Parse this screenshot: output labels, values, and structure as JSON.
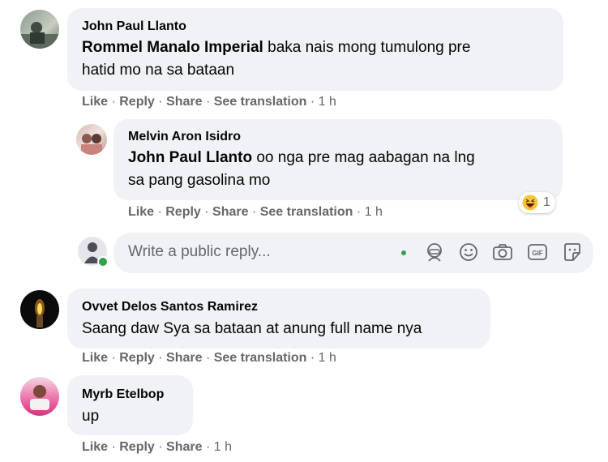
{
  "comments": [
    {
      "author": "John Paul Llanto",
      "mention": "Rommel Manalo Imperial",
      "text_line1": " baka nais mong tumulong pre",
      "text_line2": "hatid mo na sa bataan",
      "actions": {
        "like": "Like",
        "reply": "Reply",
        "share": "Share",
        "translate": "See translation",
        "time": "1 h"
      }
    },
    {
      "author": "Melvin Aron Isidro",
      "mention": "John Paul Llanto",
      "text_line1": " oo nga pre mag aabagan na lng",
      "text_line2": "sa pang gasolina mo",
      "reaction": {
        "emoji": "haha",
        "count": "1"
      },
      "actions": {
        "like": "Like",
        "reply": "Reply",
        "share": "Share",
        "translate": "See translation",
        "time": "1 h"
      }
    },
    {
      "author": "Ovvet Delos Santos Ramirez",
      "text_line1": "Saang daw Sya sa bataan at anung full name nya",
      "actions": {
        "like": "Like",
        "reply": "Reply",
        "share": "Share",
        "translate": "See translation",
        "time": "1 h"
      }
    },
    {
      "author": "Myrb Etelbop",
      "text_line1": "up",
      "actions": {
        "like": "Like",
        "reply": "Reply",
        "share": "Share",
        "time": "1 h"
      }
    }
  ],
  "reply_box": {
    "placeholder": "Write a public reply...",
    "tools": [
      "emoji-icon",
      "camera-icon",
      "gif-icon",
      "sticker-icon"
    ]
  },
  "separator": " · ",
  "colors": {
    "bubble": "#f0f2f5",
    "meta": "#65676b",
    "online": "#31a24c"
  }
}
